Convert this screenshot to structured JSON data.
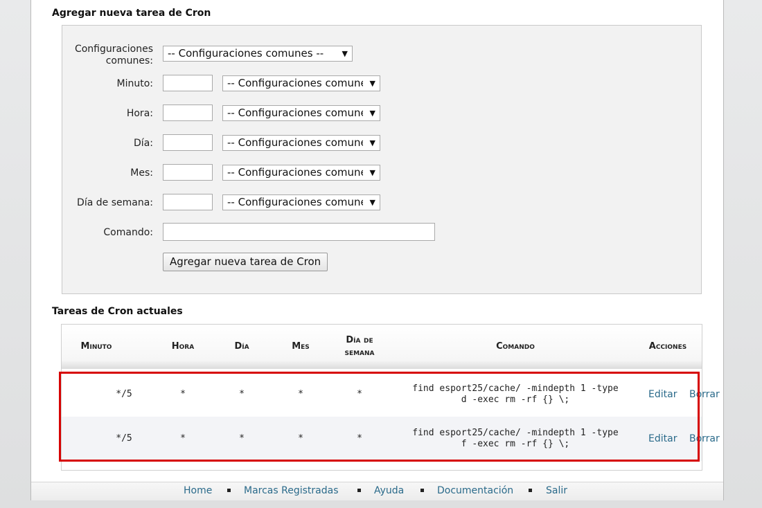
{
  "add_section": {
    "title": "Agregar nueva tarea de Cron",
    "common_settings_label_line1": "Configuraciones",
    "common_settings_label_line2": "comunes:",
    "common_settings_value": "-- Configuraciones comunes --",
    "fields": [
      {
        "label": "Minuto:",
        "select_value": "-- Configuraciones comunes --"
      },
      {
        "label": "Hora:",
        "select_value": "-- Configuraciones comunes --"
      },
      {
        "label": "Día:",
        "select_value": "-- Configuraciones comunes --"
      },
      {
        "label": "Mes:",
        "select_value": "-- Configuraciones comunes --"
      },
      {
        "label": "Día de semana:",
        "select_value": "-- Configuraciones comunes --"
      }
    ],
    "command_label": "Comando:",
    "submit_label": "Agregar nueva tarea de Cron"
  },
  "current_section": {
    "title": "Tareas de Cron actuales",
    "headers": {
      "minute": "Minuto",
      "hour": "Hora",
      "day": "Día",
      "month": "Mes",
      "weekday_line1": "Día de",
      "weekday_line2": "semana",
      "command": "Comando",
      "actions": "Acciones"
    },
    "rows": [
      {
        "minute": "*/5",
        "hour": "*",
        "day": "*",
        "month": "*",
        "weekday": "*",
        "command_line1": "find esport25/cache/ -mindepth 1 -type",
        "command_line2": "d -exec rm -rf {} \\;",
        "edit": "Editar",
        "delete": "Borrar"
      },
      {
        "minute": "*/5",
        "hour": "*",
        "day": "*",
        "month": "*",
        "weekday": "*",
        "command_line1": "find esport25/cache/ -mindepth 1 -type",
        "command_line2": "f -exec rm -rf {} \\;",
        "edit": "Editar",
        "delete": "Borrar"
      }
    ]
  },
  "footer": {
    "links": [
      "Home",
      "Marcas Registradas",
      "Ayuda",
      "Documentación",
      "Salir"
    ]
  },
  "colors": {
    "link": "#2a6a8a",
    "highlight_border": "#d60000",
    "form_background": "#f2f2f2"
  },
  "icons": {
    "select_arrow": "triangle-down-icon",
    "footer_separator": "square-bullet-icon"
  }
}
